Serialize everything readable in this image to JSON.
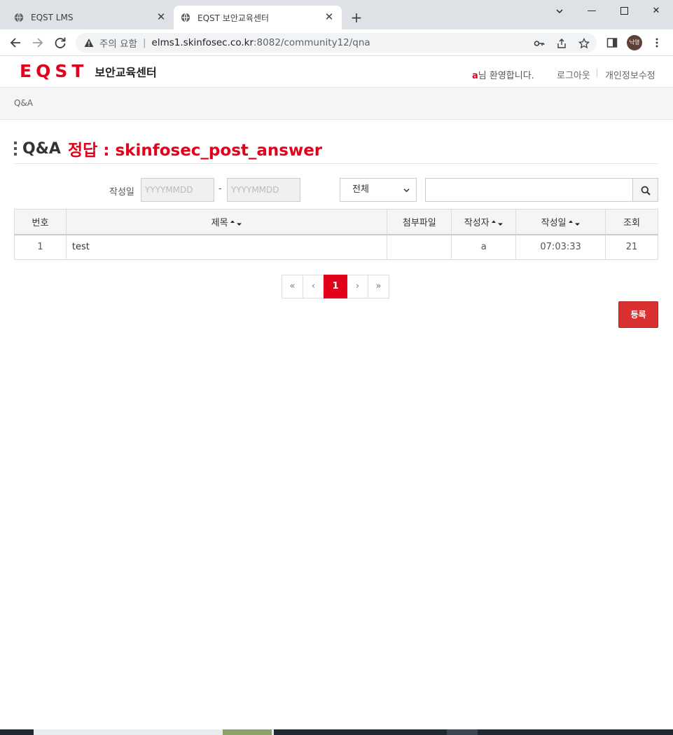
{
  "browser": {
    "tabs": [
      {
        "title": "EQST LMS",
        "active": false
      },
      {
        "title": "EQST 보안교육센터",
        "active": true
      }
    ],
    "address": {
      "warning": "주의 요함",
      "host": "elms1.skinfosec.co.kr",
      "path": ":8082/community12/qna"
    },
    "profile_initials": "낙영"
  },
  "site": {
    "logo_mark": "EQST",
    "logo_sub": "보안교육센터",
    "user_name": "a",
    "welcome_suffix": "님 환영합니다.",
    "logout": "로그아웃",
    "edit_profile": "개인정보수정",
    "breadcrumb": "Q&A"
  },
  "page": {
    "title": "Q&A",
    "answer_title": "정답 : skinfosec_post_answer"
  },
  "search": {
    "date_label": "작성일",
    "date_from_placeholder": "YYYYMMDD",
    "date_to_placeholder": "YYYYMMDD",
    "date_separator": "-",
    "scope_selected": "전체",
    "keyword": ""
  },
  "table": {
    "headers": [
      "번호",
      "제목",
      "첨부파일",
      "작성자",
      "작성일",
      "조회"
    ],
    "rows": [
      {
        "no": "1",
        "title": "test",
        "attachment": "",
        "author": "a",
        "date": "07:03:33",
        "views": "21"
      }
    ]
  },
  "pagination": {
    "first": "«",
    "prev": "‹",
    "current": "1",
    "next": "›",
    "last": "»"
  },
  "actions": {
    "register": "등록"
  },
  "colors": {
    "brand_red": "#e2001a",
    "register_button": "#d9312f"
  }
}
